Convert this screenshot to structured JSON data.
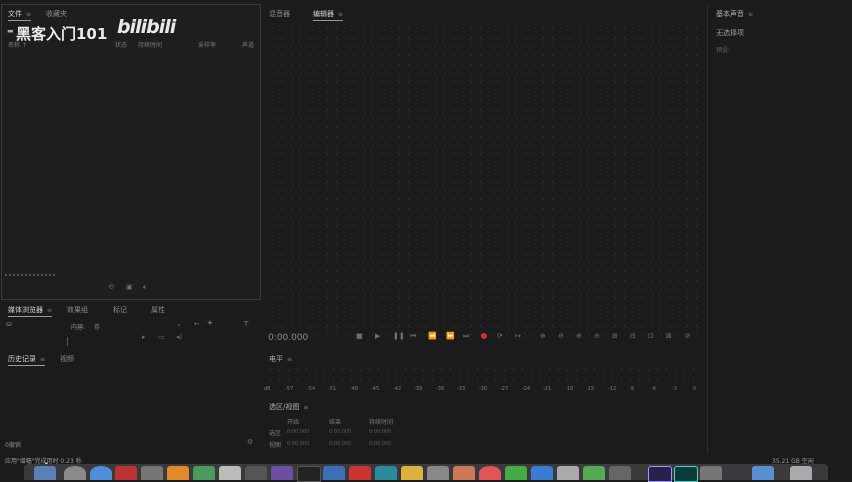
{
  "project": {
    "tabs": [
      "文件",
      "收藏夹"
    ],
    "title": "黑客入门101",
    "logo": "bilibili",
    "columns": [
      "名称",
      "状态",
      "持续时间",
      "采样率",
      "声道"
    ]
  },
  "left_tabs": [
    "媒体浏览器",
    "效果组",
    "标记",
    "属性"
  ],
  "content_label": "内容:",
  "content_value": "卷",
  "history": {
    "tabs": [
      "历史记录",
      "视频"
    ],
    "count": "0撤销"
  },
  "status_bar": {
    "left": "应用\"增幅\"完成用时 0.23 秒",
    "right": "35.21 GB 空闲"
  },
  "mixer_tabs": [
    "混音器",
    "编辑器"
  ],
  "right_panel": {
    "title": "基本声音",
    "item": "无选择项",
    "preset": "预设:"
  },
  "transport": {
    "time": "0:00.000"
  },
  "level": {
    "title": "电平",
    "ticks": [
      "dB",
      "-57",
      "-54",
      "-51",
      "-48",
      "-45",
      "-42",
      "-39",
      "-36",
      "-33",
      "-30",
      "-27",
      "-24",
      "-21",
      "-18",
      "-15",
      "-12",
      "-9",
      "-6",
      "-3",
      "0"
    ]
  },
  "selection": {
    "title": "选区/视图",
    "headers": [
      "开始",
      "结束",
      "持续时间"
    ],
    "rows": [
      {
        "label": "选区",
        "start": "0:00.000",
        "end": "0:00.000",
        "duration": "0:00.000"
      },
      {
        "label": "视图",
        "start": "0:00.000",
        "end": "0:00.000",
        "duration": "0:00.000"
      }
    ]
  },
  "colors": {
    "background": "#1b1b1b",
    "record": "#d23030",
    "accent_text": "#d6d6d6"
  }
}
